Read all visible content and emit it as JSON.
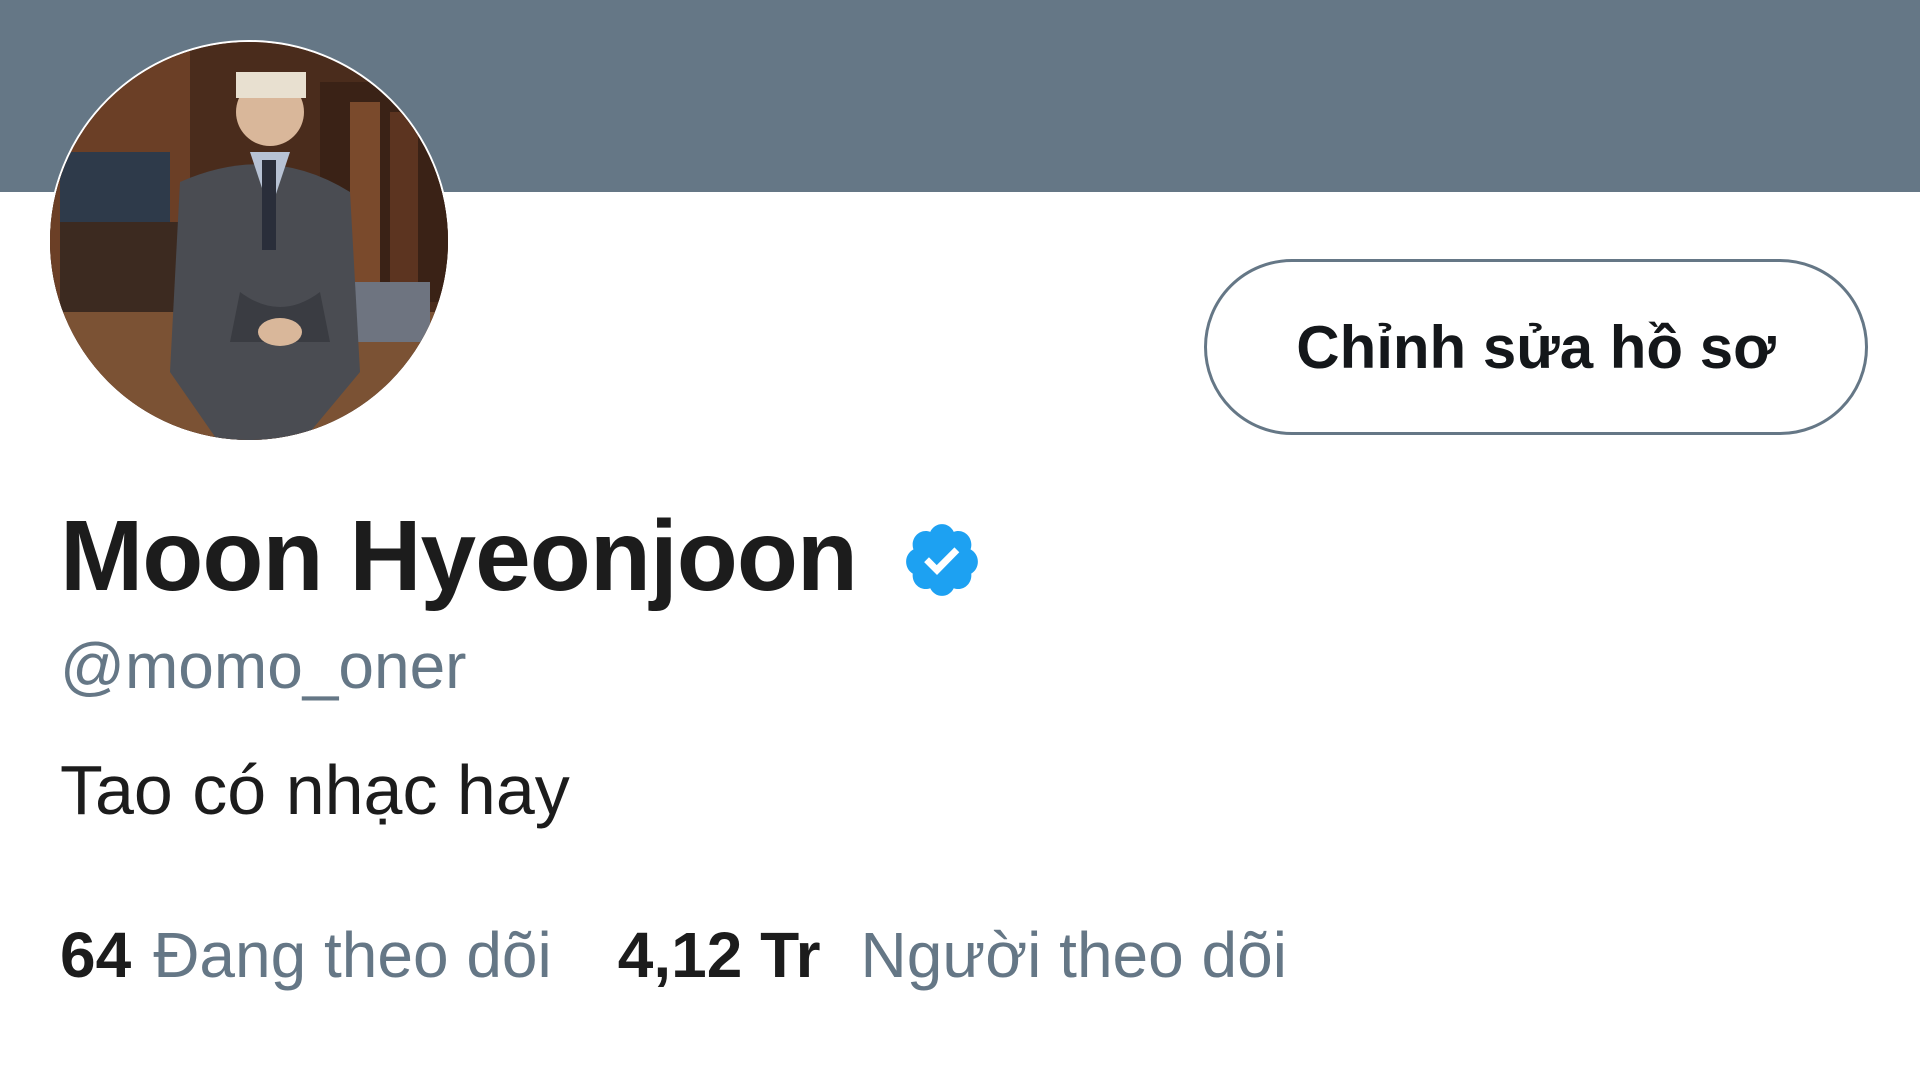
{
  "profile": {
    "display_name": "Moon Hyeonjoon",
    "handle": "@momo_oner",
    "bio": "Tao có nhạc hay",
    "verified": true,
    "edit_button_label": "Chỉnh sửa hồ sơ"
  },
  "stats": {
    "following_count": "64",
    "following_label": "Đang theo dõi",
    "followers_count": "4,12 Tr",
    "followers_label": "Người theo dõi"
  },
  "colors": {
    "banner": "#657786",
    "verified_badge": "#1da1f2",
    "secondary_text": "#657786",
    "primary_text": "#14171a"
  },
  "icons": {
    "verified": "verified-badge-icon",
    "avatar": "profile-avatar"
  }
}
